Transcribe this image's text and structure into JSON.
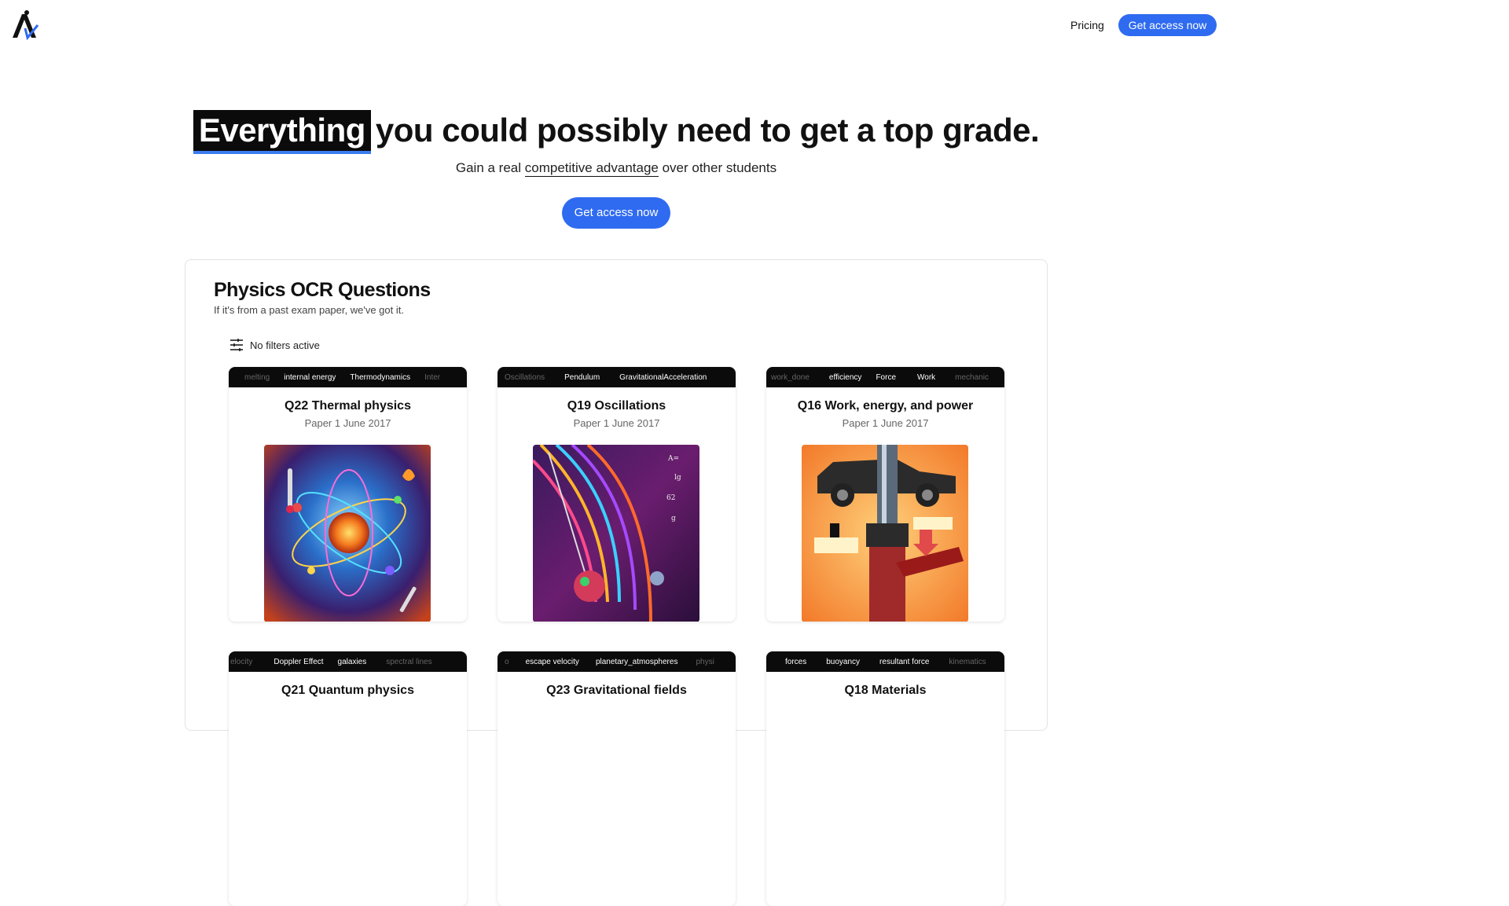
{
  "nav": {
    "pricing": "Pricing",
    "cta": "Get access now"
  },
  "hero": {
    "title_highlight": "Everything",
    "title_rest": "you could possibly need to get a top grade.",
    "sub_before": "Gain a real ",
    "sub_link": "competitive advantage",
    "sub_after": " over other students",
    "cta": "Get access now"
  },
  "panel": {
    "title": "Physics OCR Questions",
    "subtitle": "If it's from a past exam paper, we've got it.",
    "filters_label": "No filters active"
  },
  "cards": [
    {
      "tags": [
        "melting",
        "internal energy",
        "Thermodynamics",
        "Inter"
      ],
      "title": "Q22 Thermal physics",
      "meta": "Paper 1 June 2017",
      "image": "atom-thermal-physics-art"
    },
    {
      "tags": [
        "Oscillations",
        "Pendulum",
        "GravitationalAcceleration"
      ],
      "title": "Q19 Oscillations",
      "meta": "Paper 1 June 2017",
      "image": "pendulum-oscillation-art"
    },
    {
      "tags": [
        "work_done",
        "efficiency",
        "Force",
        "Work",
        "mechanic"
      ],
      "title": "Q16 Work, energy, and power",
      "meta": "Paper 1 June 2017",
      "image": "car-hydraulic-lift-art"
    },
    {
      "tags": [
        "elocity",
        "Doppler Effect",
        "galaxies",
        "spectral lines"
      ],
      "title": "Q21 Quantum physics",
      "meta": ""
    },
    {
      "tags": [
        "o",
        "escape velocity",
        "planetary_atmospheres",
        "physi"
      ],
      "title": "Q23 Gravitational fields",
      "meta": ""
    },
    {
      "tags": [
        "forces",
        "buoyancy",
        "resultant force",
        "kinematics"
      ],
      "title": "Q18 Materials",
      "meta": ""
    }
  ],
  "colors": {
    "accent": "#2f6bf0",
    "tagbar": "#0b0b0b",
    "highlight_underline": "#3b7cf0"
  }
}
